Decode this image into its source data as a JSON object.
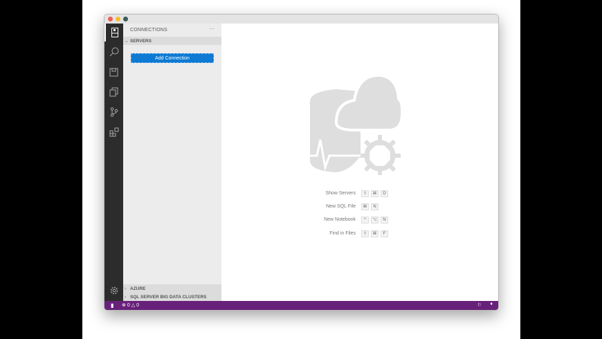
{
  "window": {
    "traffic_lights": [
      "#ee5f57",
      "#f5be2f",
      "#3d5a5a"
    ]
  },
  "activity_bar": {
    "items": [
      "connections",
      "search",
      "notebook",
      "explorer",
      "source-control",
      "extensions"
    ],
    "bottom": "settings"
  },
  "sidebar": {
    "title": "CONNECTIONS",
    "more": "···",
    "servers_label": "SERVERS",
    "add_connection": "Add Connection",
    "azure_label": "AZURE",
    "bdc_label": "SQL SERVER BIG DATA CLUSTERS"
  },
  "main": {
    "shortcuts": [
      {
        "label": "Show Servers",
        "keys": [
          "⇧",
          "⌘",
          "D"
        ]
      },
      {
        "label": "New SQL File",
        "keys": [
          "⌘",
          "N"
        ]
      },
      {
        "label": "New Notebook",
        "keys": [
          "^",
          "⌥",
          "N"
        ]
      },
      {
        "label": "Find in Files",
        "keys": [
          "⇧",
          "⌘",
          "F"
        ]
      }
    ]
  },
  "status_bar": {
    "errors": "0",
    "warnings": "0",
    "color": "#68217a"
  }
}
